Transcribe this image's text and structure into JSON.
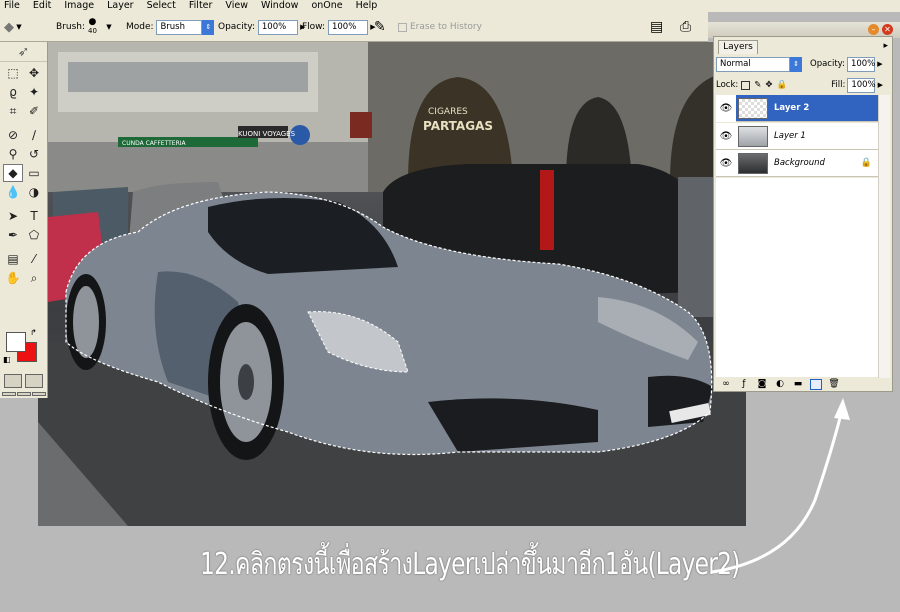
{
  "menu": [
    "File",
    "Edit",
    "Image",
    "Layer",
    "Select",
    "Filter",
    "View",
    "Window",
    "onOne",
    "Help"
  ],
  "options": {
    "brush_label": "Brush:",
    "brush_size": "40",
    "mode_label": "Mode:",
    "mode_value": "Brush",
    "opacity_label": "Opacity:",
    "opacity_value": "100%",
    "flow_label": "Flow:",
    "flow_value": "100%",
    "erase_to_history": "Erase to History"
  },
  "canvas": {
    "signs": [
      "CIGARES",
      "PARTAGAS",
      "KUONI VOYAGES",
      "CUNDA CAFFETTERIA"
    ]
  },
  "layers_panel": {
    "tab": "Layers",
    "blend_mode": "Normal",
    "opacity_label": "Opacity:",
    "opacity_value": "100%",
    "lock_label": "Lock:",
    "fill_label": "Fill:",
    "fill_value": "100%",
    "layers": [
      {
        "name": "Layer 2",
        "selected": true
      },
      {
        "name": "Layer 1",
        "selected": false
      },
      {
        "name": "Background",
        "selected": false,
        "locked": true
      }
    ]
  },
  "caption": "12.คลิกตรงนี้เพื่อสร้างLayerเปล่าขึ้นมาอีก1อัน(Layer2)",
  "colors": {
    "foreground": "#ffffff",
    "background": "#ee1111",
    "selection_highlight": "#3064c0"
  }
}
